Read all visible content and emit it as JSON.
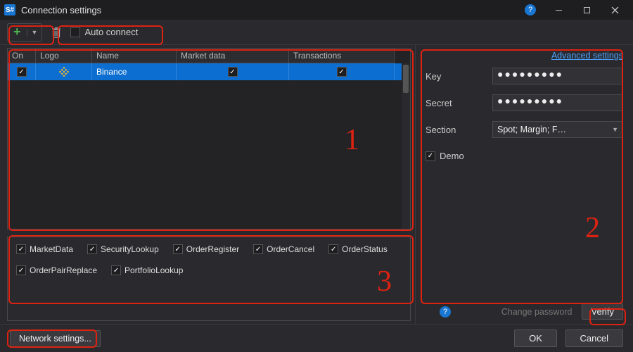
{
  "window": {
    "title": "Connection settings",
    "appLogoText": "S#"
  },
  "toolbar": {
    "autoConnectLabel": "Auto connect",
    "autoConnectChecked": false
  },
  "grid": {
    "columns": [
      "On",
      "Logo",
      "Name",
      "Market data",
      "Transactions"
    ],
    "rows": [
      {
        "on": true,
        "logo": "binance",
        "name": "Binance",
        "marketData": true,
        "transactions": true
      }
    ]
  },
  "features": [
    "MarketData",
    "SecurityLookup",
    "OrderRegister",
    "OrderCancel",
    "OrderStatus",
    "OrderPairReplace",
    "PortfolioLookup"
  ],
  "rightPanel": {
    "advancedLink": "Advanced settings",
    "keyLabel": "Key",
    "keyValue": "●●●●●●●●●",
    "secretLabel": "Secret",
    "secretValue": "●●●●●●●●●",
    "sectionLabel": "Section",
    "sectionValue": "Spot; Margin; F…",
    "demoLabel": "Demo",
    "demoChecked": true,
    "changePassword": "Change password",
    "verify": "Verify"
  },
  "footer": {
    "networkSettings": "Network settings...",
    "ok": "OK",
    "cancel": "Cancel"
  },
  "annotations": {
    "one": "1",
    "two": "2",
    "three": "3"
  }
}
